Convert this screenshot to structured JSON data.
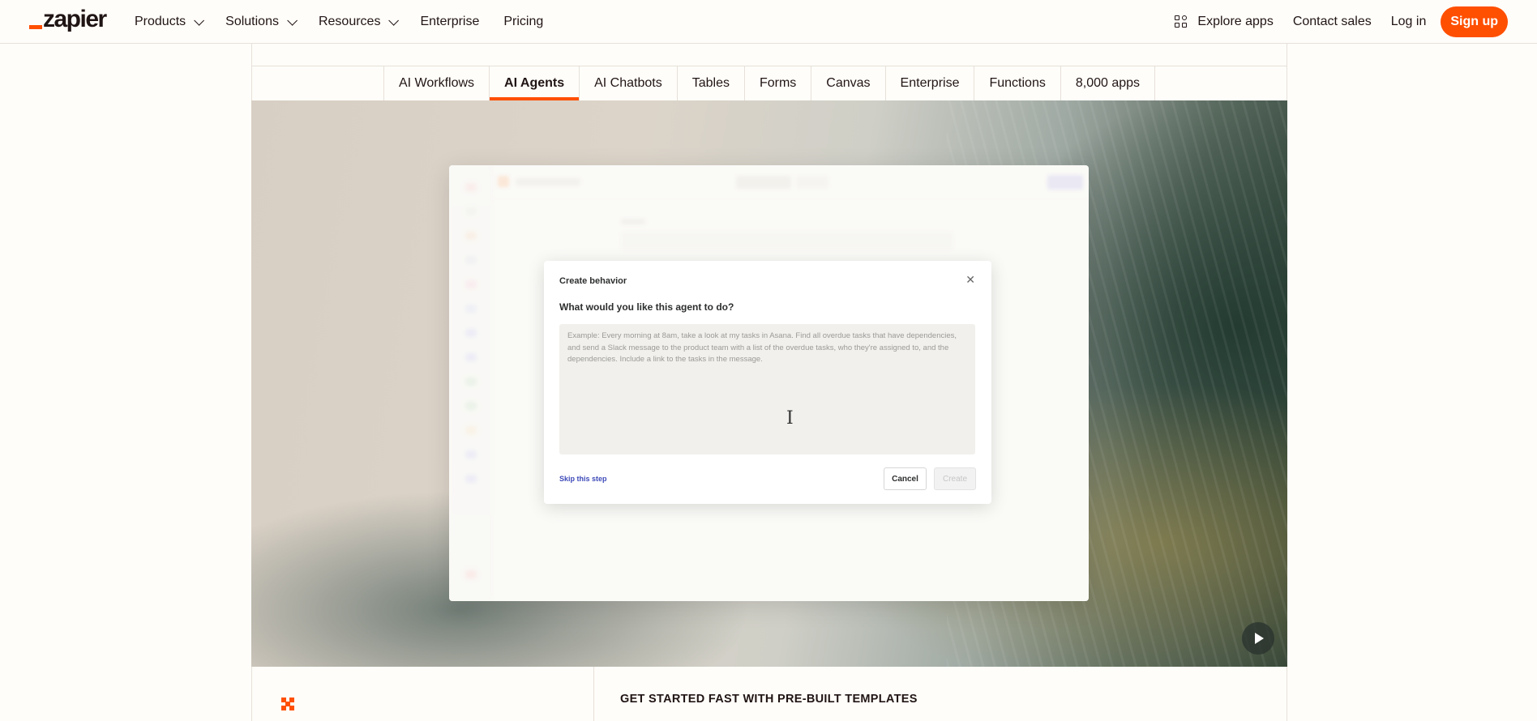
{
  "brand": {
    "logo_text": "zapier",
    "accent": "#ff4f00"
  },
  "nav": {
    "left": [
      {
        "label": "Products",
        "has_menu": true
      },
      {
        "label": "Solutions",
        "has_menu": true
      },
      {
        "label": "Resources",
        "has_menu": true
      },
      {
        "label": "Enterprise",
        "has_menu": false
      },
      {
        "label": "Pricing",
        "has_menu": false
      }
    ],
    "explore_apps": "Explore apps",
    "contact_sales": "Contact sales",
    "log_in": "Log in",
    "sign_up": "Sign up"
  },
  "tabs": [
    {
      "label": "AI Workflows",
      "active": false
    },
    {
      "label": "AI Agents",
      "active": true
    },
    {
      "label": "AI Chatbots",
      "active": false
    },
    {
      "label": "Tables",
      "active": false
    },
    {
      "label": "Forms",
      "active": false
    },
    {
      "label": "Canvas",
      "active": false
    },
    {
      "label": "Enterprise",
      "active": false
    },
    {
      "label": "Functions",
      "active": false
    },
    {
      "label": "8,000 apps",
      "active": false
    }
  ],
  "modal": {
    "title": "Create behavior",
    "question": "What would you like this agent to do?",
    "placeholder": "Example: Every morning at 8am, take a look at my tasks in Asana. Find all overdue tasks that have dependencies, and send a Slack message to the product team with a list of the overdue tasks, who they're assigned to, and the dependencies. Include a link to the tasks in the message.",
    "skip": "Skip this step",
    "cancel": "Cancel",
    "create": "Create"
  },
  "section": {
    "heading": "GET STARTED FAST WITH PRE-BUILT TEMPLATES"
  }
}
